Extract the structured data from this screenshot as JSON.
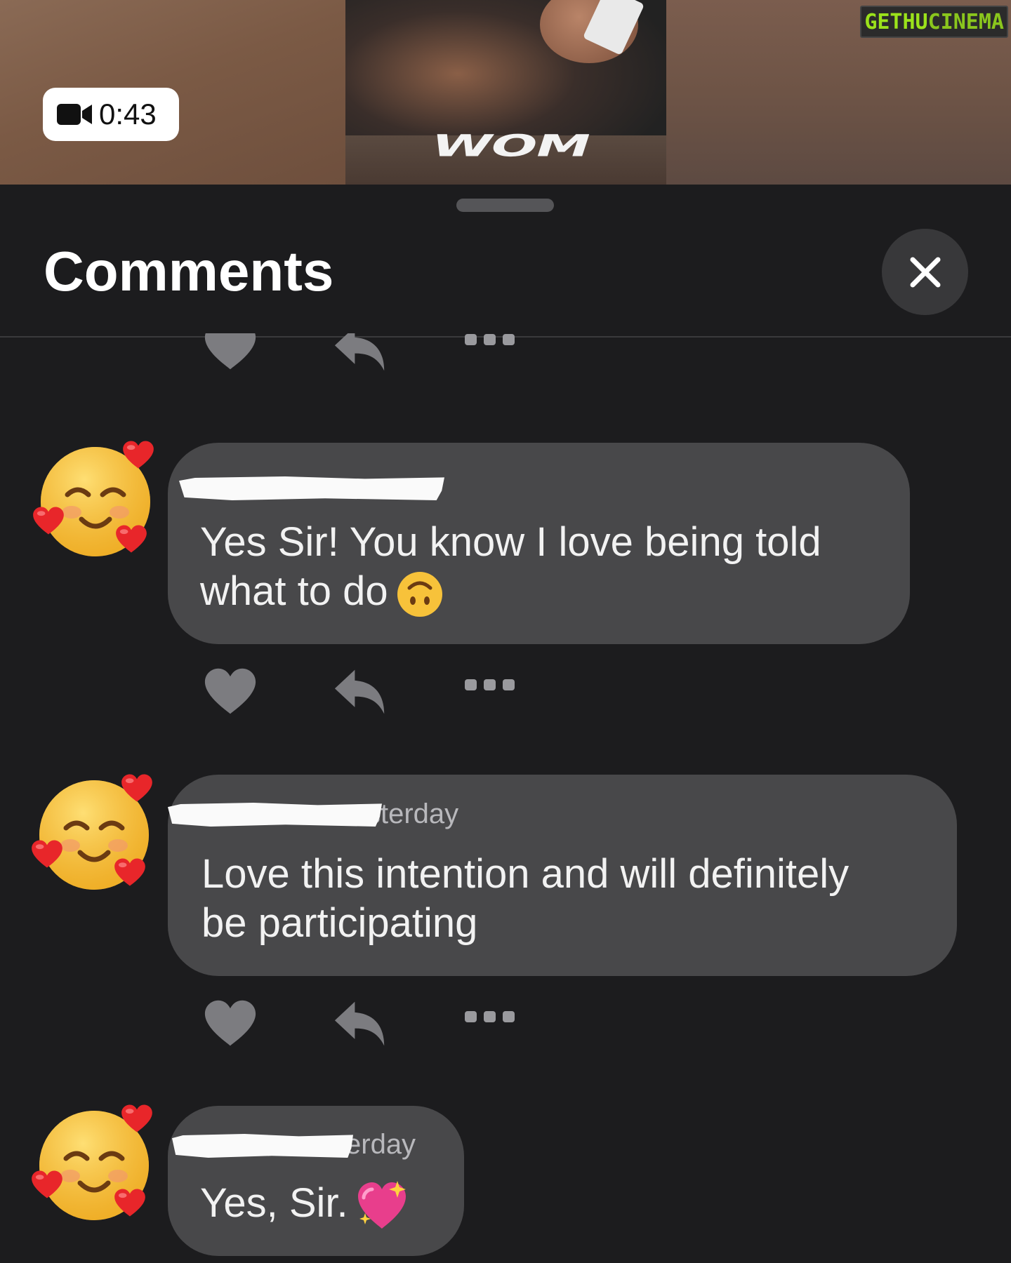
{
  "media": {
    "video_duration": "0:43",
    "watermark_part1": "GETHU",
    "watermark_part2": "CINEMA",
    "thumbnail_text": "WOM"
  },
  "sheet": {
    "title": "Comments",
    "close_icon": "close-icon"
  },
  "actions": {
    "like_icon": "heart-icon",
    "reply_icon": "reply-icon",
    "more_icon": "more-dots-icon"
  },
  "comments": [
    {
      "avatar": "smiling-face-with-hearts-emoji",
      "meta": "",
      "text_line1": "Yes Sir! You know I love being told",
      "text_line2": "what to do",
      "inline_emoji": "upside-down-face-emoji"
    },
    {
      "avatar": "smiling-face-with-hearts-emoji",
      "meta": "sterday",
      "text_line1": "Love this intention and will definitely",
      "text_line2": "be participating"
    },
    {
      "avatar": "smiling-face-with-hearts-emoji",
      "meta": "erday",
      "text_line1": "Yes, Sir.",
      "inline_emoji": "sparkling-heart-emoji"
    }
  ],
  "colors": {
    "background": "#1c1c1e",
    "bubble": "#48484a",
    "icon_gray": "#7c7c80",
    "text": "#f2f2f2",
    "meta": "#b8b8bc"
  }
}
